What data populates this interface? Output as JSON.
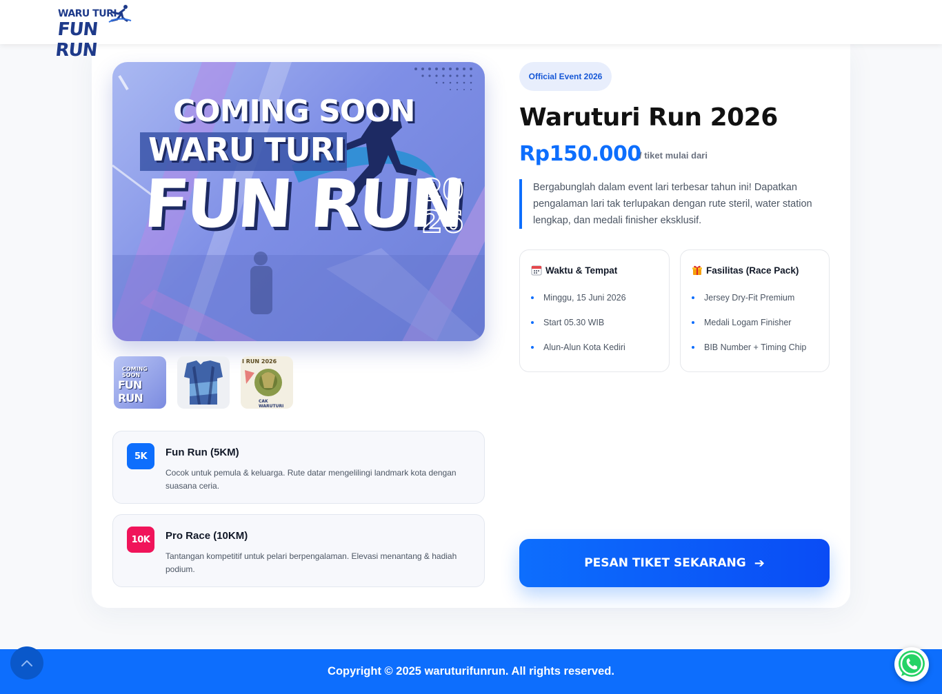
{
  "header": {
    "logo_line1": "WARU TURI",
    "logo_line2": "FUN RUN"
  },
  "poster": {
    "line1": "COMING SOON",
    "line2": "WARU TURI",
    "line3": "FUN RUN",
    "year_top": "20",
    "year_bottom": "26"
  },
  "thumbnails": [
    {
      "name": "poster",
      "text_top": "COMING SOON",
      "text_main": "FUN RUN"
    },
    {
      "name": "jersey"
    },
    {
      "name": "medal",
      "text_top": "I RUN 2026",
      "text_bottom": "CAK WARUTURI"
    }
  ],
  "categories": [
    {
      "badge": "5K",
      "title": "Fun Run (5KM)",
      "description": "Cocok untuk pemula & keluarga. Rute datar mengelilingi landmark kota dengan suasana ceria.",
      "color": "#0d6efd"
    },
    {
      "badge": "10K",
      "title": "Pro Race (10KM)",
      "description": "Tantangan kompetitif untuk pelari berpengalaman. Elevasi menantang & hadiah podium.",
      "color": "#f0145a"
    }
  ],
  "event": {
    "badge": "Official Event 2026",
    "title": "Waruturi Run 2026",
    "price": "Rp150.000",
    "price_note": "/ tiket mulai dari",
    "description": "Bergabunglah dalam event lari terbesar tahun ini! Dapatkan pengalaman lari tak terlupakan dengan rute steril, water station lengkap, dan medali finisher eksklusif."
  },
  "info_cards": [
    {
      "title": "Waktu & Tempat",
      "icon": "calendar-icon",
      "items": [
        "Minggu, 15 Juni 2026",
        "Start 05.30 WIB",
        "Alun-Alun Kota Kediri"
      ]
    },
    {
      "title": "Fasilitas (Race Pack)",
      "icon": "gift-icon",
      "items": [
        "Jersey Dry-Fit Premium",
        "Medali Logam Finisher",
        "BIB Number + Timing Chip"
      ]
    }
  ],
  "cta": {
    "label": "PESAN TIKET SEKARANG",
    "arrow": "➔"
  },
  "footer": {
    "copyright": "Copyright © 2025 waruturifunrun. All rights reserved."
  },
  "colors": {
    "primary": "#0d6efd",
    "accent": "#f0145a",
    "footer": "#0d6efd"
  }
}
